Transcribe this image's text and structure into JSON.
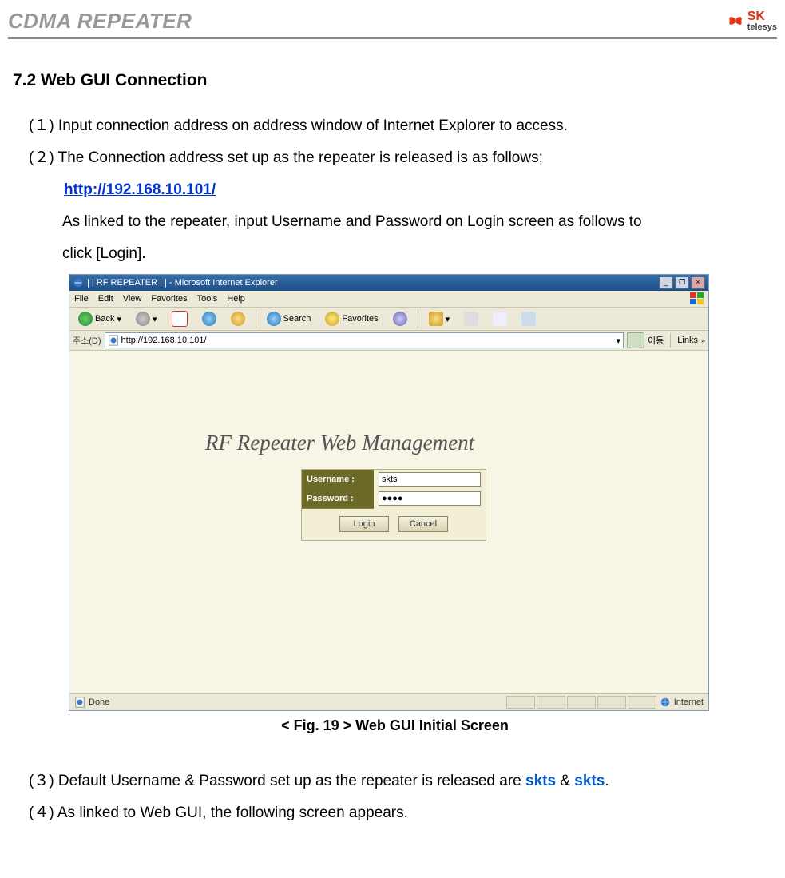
{
  "header": {
    "title": "CDMA REPEATER",
    "logo_sk": "SK",
    "logo_telesys": "telesys"
  },
  "section": {
    "number_title": "7.2  Web GUI Connection",
    "item1": "(１)  Input connection address on address window of Internet Explorer to access.",
    "item2": "(２)  The Connection address set up as the repeater is released is as follows;",
    "link": "http://192.168.10.101/",
    "para1a": "As linked to the repeater, input Username and Password on Login screen as follows    to",
    "para1b": "click [Login].",
    "figcaption": "< Fig. 19 > Web GUI Initial Screen",
    "item3_pre": "(３)  Default Username & Password set up as the repeater is released are ",
    "item3_u": "skts",
    "item3_mid": " & ",
    "item3_p": "skts",
    "item3_post": ".",
    "item4": "(４)  As linked to Web GUI, the following screen appears."
  },
  "ie": {
    "title": "| | RF REPEATER | | - Microsoft Internet Explorer",
    "menu": {
      "file": "File",
      "edit": "Edit",
      "view": "View",
      "fav": "Favorites",
      "tools": "Tools",
      "help": "Help"
    },
    "toolbar": {
      "back": "Back",
      "search": "Search",
      "favorites": "Favorites"
    },
    "addr_label": "주소(D)",
    "url": "http://192.168.10.101/",
    "go_label": "이동",
    "links_label": "Links",
    "content_title": "RF Repeater Web Management",
    "login": {
      "user_label": "Username :",
      "pass_label": "Password :",
      "user_value": "skts",
      "pass_value": "●●●●",
      "login_btn": "Login",
      "cancel_btn": "Cancel"
    },
    "status_done": "Done",
    "status_zone": "Internet"
  }
}
